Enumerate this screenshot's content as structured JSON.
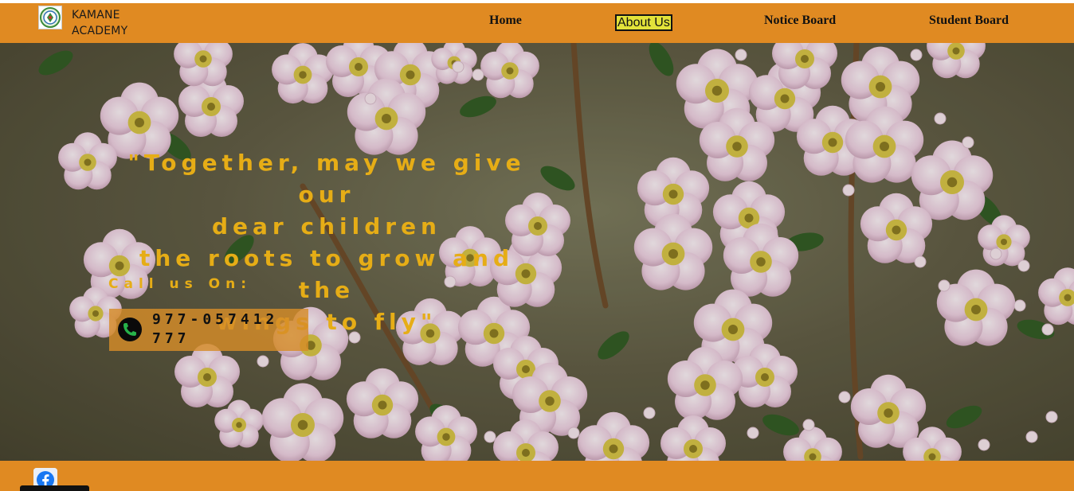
{
  "brand": {
    "line1": "KAMANE",
    "line2": "ACADEMY",
    "logo_icon": "school-crest-icon"
  },
  "nav": {
    "home": "Home",
    "about": "About Us",
    "notice": "Notice Board",
    "student": "Student Board"
  },
  "hero": {
    "quote_line1": "\"Together, may we give our",
    "quote_line2": "dear children",
    "quote_line3": "the roots to grow and the",
    "quote_line4": "wings to fly\"",
    "call_label": "Call us On:",
    "phone_icon": "phone-icon",
    "phone_number": "977-057412777"
  },
  "footer": {
    "social_icon": "facebook-icon"
  },
  "colors": {
    "header_bg": "#e08a22",
    "quote_text": "#e6ad16",
    "phone_box": "#d68c28",
    "active_nav_bg": "#e2e23a"
  }
}
